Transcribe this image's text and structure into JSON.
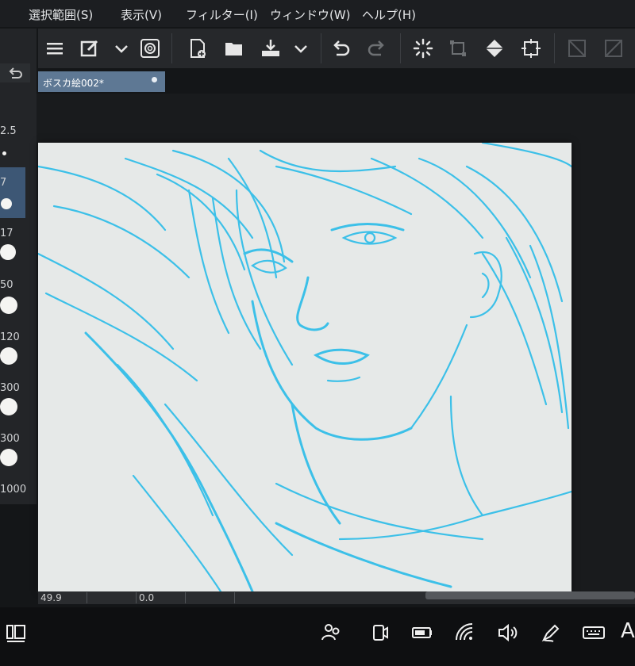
{
  "menu": {
    "items": [
      {
        "label": "選択範囲(S)"
      },
      {
        "label": "表示(V)"
      },
      {
        "label": "フィルター(I)"
      },
      {
        "label": "ウィンドウ(W)"
      },
      {
        "label": "ヘルプ(H)"
      }
    ]
  },
  "toolbar": {
    "icons": [
      "menu-icon",
      "edit-layer-icon",
      "chevron-down-icon",
      "spiral-icon",
      "new-file-icon",
      "open-folder-icon",
      "download-icon",
      "chevron-down-icon",
      "undo-icon",
      "redo-icon",
      "loading-spinner-icon",
      "transform-icon",
      "fill-bucket-icon",
      "crop-icon",
      "grid-select-icon",
      "grid-select-alt-icon"
    ]
  },
  "tab": {
    "title": "ボスカ絵002*"
  },
  "brush_sizes": {
    "labels": [
      "2.5",
      "7",
      "17",
      "50",
      "120",
      "300",
      "300",
      "1000"
    ]
  },
  "status": {
    "zoom": "49.9",
    "angle": "0.0"
  },
  "taskbar": {
    "keyboard_label": "A",
    "icons": [
      "task-view-icon",
      "people-icon",
      "camera-icon",
      "battery-icon",
      "wifi-icon",
      "volume-icon",
      "pen-icon",
      "keyboard-icon"
    ]
  },
  "colors": {
    "accent": "#5e7894",
    "sketch": "#3cc0e8",
    "canvas": "#e6e9e8"
  }
}
